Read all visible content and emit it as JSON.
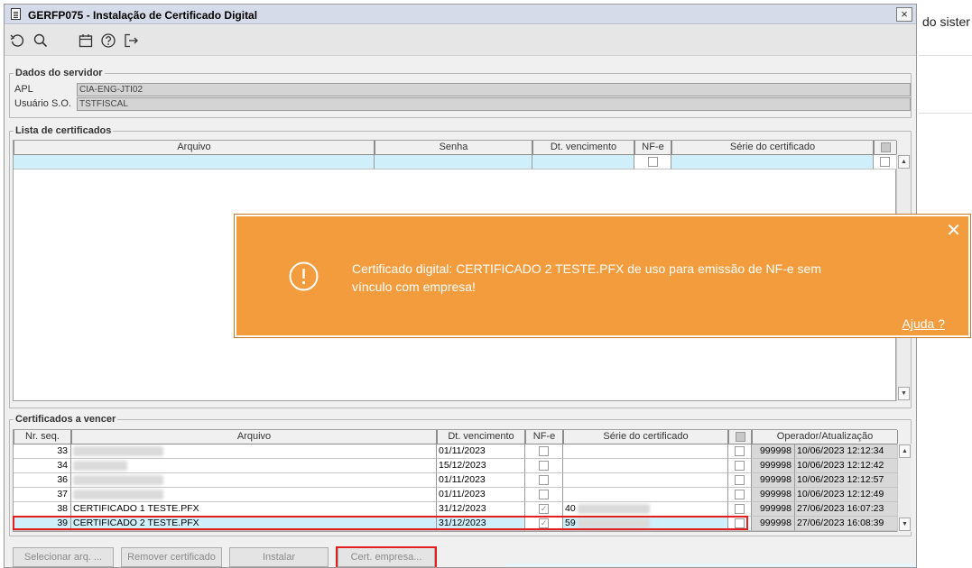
{
  "window": {
    "title": "GERFP075 - Instalação de Certificado Digital",
    "close_glyph": "×"
  },
  "background_app": {
    "text": "do sister"
  },
  "toolbar": {
    "icons": [
      "refresh-icon",
      "search-icon",
      "calendar-icon",
      "help-icon",
      "exit-icon"
    ]
  },
  "servidor": {
    "legend": "Dados do servidor",
    "apl_label": "APL",
    "apl_value": "CIA-ENG-JTI02",
    "usuario_label": "Usuário S.O.",
    "usuario_value": "TSTFISCAL"
  },
  "lista": {
    "legend": "Lista de certificados",
    "headers": {
      "arquivo": "Arquivo",
      "senha": "Senha",
      "vencimento": "Dt. vencimento",
      "nfe": "NF-e",
      "serie": "Série do certificado"
    }
  },
  "vencer": {
    "legend": "Certificados a vencer",
    "headers": {
      "seq": "Nr. seq.",
      "arquivo": "Arquivo",
      "vencimento": "Dt. vencimento",
      "nfe": "NF-e",
      "serie": "Série do certificado",
      "operador": "Operador/Atualização"
    },
    "rows": [
      {
        "seq": "33",
        "arquivo": "",
        "vencimento": "01/11/2023",
        "nfe": false,
        "serie": "",
        "operador": "999998",
        "atualizacao": "10/06/2023 12:12:34"
      },
      {
        "seq": "34",
        "arquivo": "",
        "vencimento": "15/12/2023",
        "nfe": false,
        "serie": "",
        "operador": "999998",
        "atualizacao": "10/06/2023 12:12:42"
      },
      {
        "seq": "36",
        "arquivo": "",
        "vencimento": "01/11/2023",
        "nfe": false,
        "serie": "",
        "operador": "999998",
        "atualizacao": "10/06/2023 12:12:57"
      },
      {
        "seq": "37",
        "arquivo": "",
        "vencimento": "01/11/2023",
        "nfe": false,
        "serie": "",
        "operador": "999998",
        "atualizacao": "10/06/2023 12:12:49"
      },
      {
        "seq": "38",
        "arquivo": "CERTIFICADO 1 TESTE.PFX",
        "vencimento": "31/12/2023",
        "nfe": true,
        "serie": "40",
        "operador": "999998",
        "atualizacao": "27/06/2023 16:07:23"
      },
      {
        "seq": "39",
        "arquivo": "CERTIFICADO 2 TESTE.PFX",
        "vencimento": "31/12/2023",
        "nfe": true,
        "serie": "59",
        "operador": "999998",
        "atualizacao": "27/06/2023 16:08:39"
      }
    ]
  },
  "buttons": {
    "selecionar": "Selecionar arq. ...",
    "remover": "Remover certificado",
    "instalar": "Instalar",
    "cert_empresa": "Cert. empresa..."
  },
  "toast": {
    "message": "Certificado digital: CERTIFICADO 2 TESTE.PFX de uso para emissão de NF-e sem vínculo com empresa!",
    "help": "Ajuda ?",
    "close_glyph": "✕",
    "color": "#f39c3d"
  },
  "highlight_color": "#e41e1e"
}
